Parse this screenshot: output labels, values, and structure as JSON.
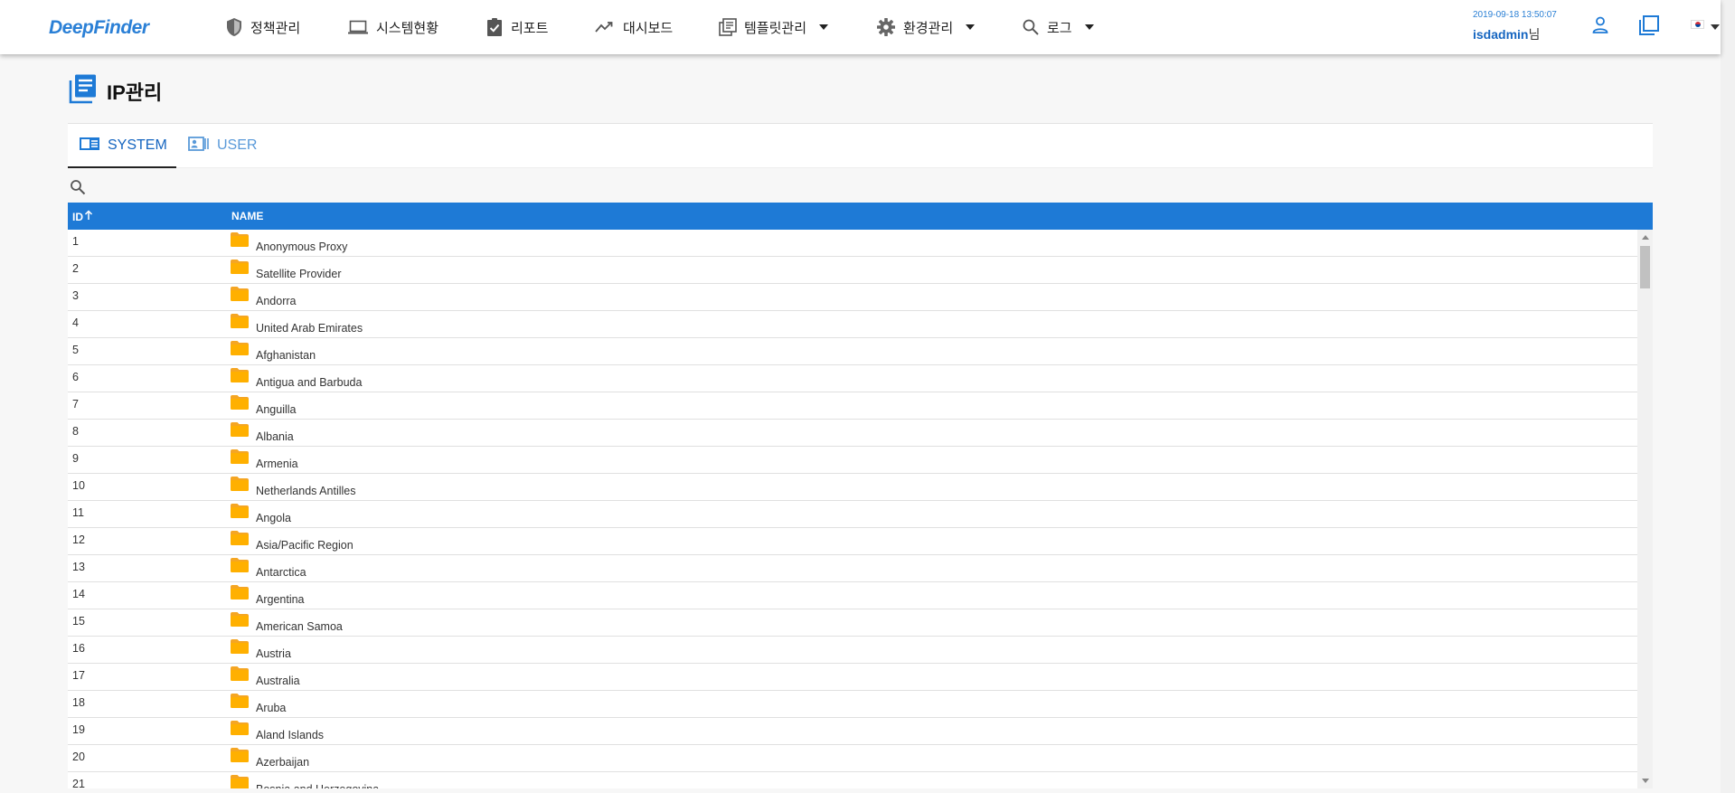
{
  "header": {
    "logo_text": "DeepFinder",
    "nav": [
      {
        "label": "정책관리",
        "icon": "shield-icon"
      },
      {
        "label": "시스템현황",
        "icon": "laptop-icon"
      },
      {
        "label": "리포트",
        "icon": "clipboard-check-icon"
      },
      {
        "label": "대시보드",
        "icon": "trending-icon"
      },
      {
        "label": "템플릿관리",
        "icon": "template-icon",
        "dropdown": true
      },
      {
        "label": "환경관리",
        "icon": "gear-icon",
        "dropdown": true
      },
      {
        "label": "로그",
        "icon": "search-icon",
        "dropdown": true
      }
    ],
    "datetime": "2019-09-18 13:50:07",
    "username": "isdadmin",
    "username_suffix": "님",
    "language_flag": "korea-flag-icon",
    "accent_color": "#1e7ad6"
  },
  "page": {
    "title": "IP관리",
    "title_icon": "document-list-icon"
  },
  "tabs": [
    {
      "label": "SYSTEM",
      "icon": "system-tab-icon",
      "active": true
    },
    {
      "label": "USER",
      "icon": "contact-card-icon",
      "active": false
    }
  ],
  "search": {
    "icon": "search-icon"
  },
  "table": {
    "columns": [
      "ID",
      "NAME"
    ],
    "sort": {
      "column": "ID",
      "direction": "asc"
    },
    "rows": [
      {
        "id": "1",
        "name": "Anonymous Proxy"
      },
      {
        "id": "2",
        "name": "Satellite Provider"
      },
      {
        "id": "3",
        "name": "Andorra"
      },
      {
        "id": "4",
        "name": "United Arab Emirates"
      },
      {
        "id": "5",
        "name": "Afghanistan"
      },
      {
        "id": "6",
        "name": "Antigua and Barbuda"
      },
      {
        "id": "7",
        "name": "Anguilla"
      },
      {
        "id": "8",
        "name": "Albania"
      },
      {
        "id": "9",
        "name": "Armenia"
      },
      {
        "id": "10",
        "name": "Netherlands Antilles"
      },
      {
        "id": "11",
        "name": "Angola"
      },
      {
        "id": "12",
        "name": "Asia/Pacific Region"
      },
      {
        "id": "13",
        "name": "Antarctica"
      },
      {
        "id": "14",
        "name": "Argentina"
      },
      {
        "id": "15",
        "name": "American Samoa"
      },
      {
        "id": "16",
        "name": "Austria"
      },
      {
        "id": "17",
        "name": "Australia"
      },
      {
        "id": "18",
        "name": "Aruba"
      },
      {
        "id": "19",
        "name": "Aland Islands"
      },
      {
        "id": "20",
        "name": "Azerbaijan"
      },
      {
        "id": "21",
        "name": "Bosnia and Herzegovina"
      }
    ]
  }
}
